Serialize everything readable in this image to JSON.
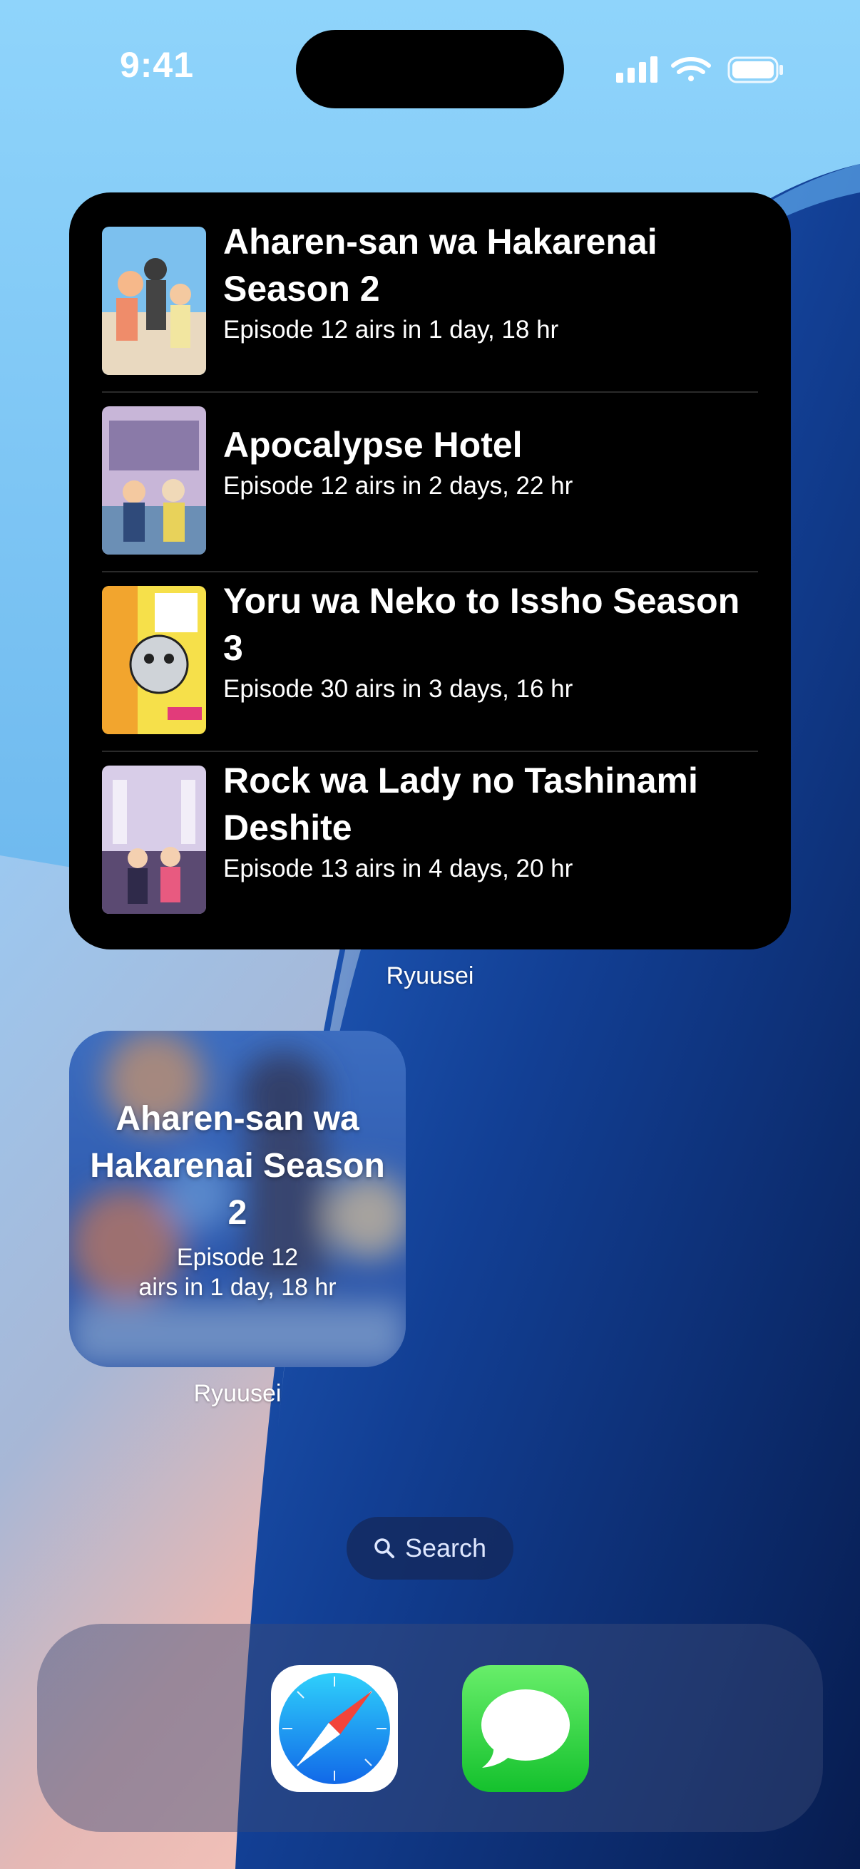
{
  "status_bar": {
    "time": "9:41"
  },
  "large_widget": {
    "items": [
      {
        "title": "Aharen-san wa Hakarenai Season 2",
        "subtitle": "Episode 12 airs in 1 day, 18 hr"
      },
      {
        "title": "Apocalypse Hotel",
        "subtitle": "Episode 12 airs in 2 days, 22 hr"
      },
      {
        "title": "Yoru wa Neko to Issho Season 3",
        "subtitle": "Episode 30 airs in 3 days, 16 hr"
      },
      {
        "title": "Rock wa Lady no Tashinami Deshite",
        "subtitle": "Episode 13 airs in 4 days, 20 hr"
      }
    ],
    "app_label": "Ryuusei"
  },
  "small_widget": {
    "title": "Aharen-san wa Hakarenai Season 2",
    "subtitle_line1": "Episode 12",
    "subtitle_line2": "airs in 1 day, 18 hr",
    "app_label": "Ryuusei"
  },
  "search": {
    "label": "Search",
    "icon": "search-icon"
  },
  "dock": {
    "apps": [
      {
        "name": "Safari",
        "icon": "safari-icon"
      },
      {
        "name": "Messages",
        "icon": "messages-icon"
      }
    ]
  }
}
